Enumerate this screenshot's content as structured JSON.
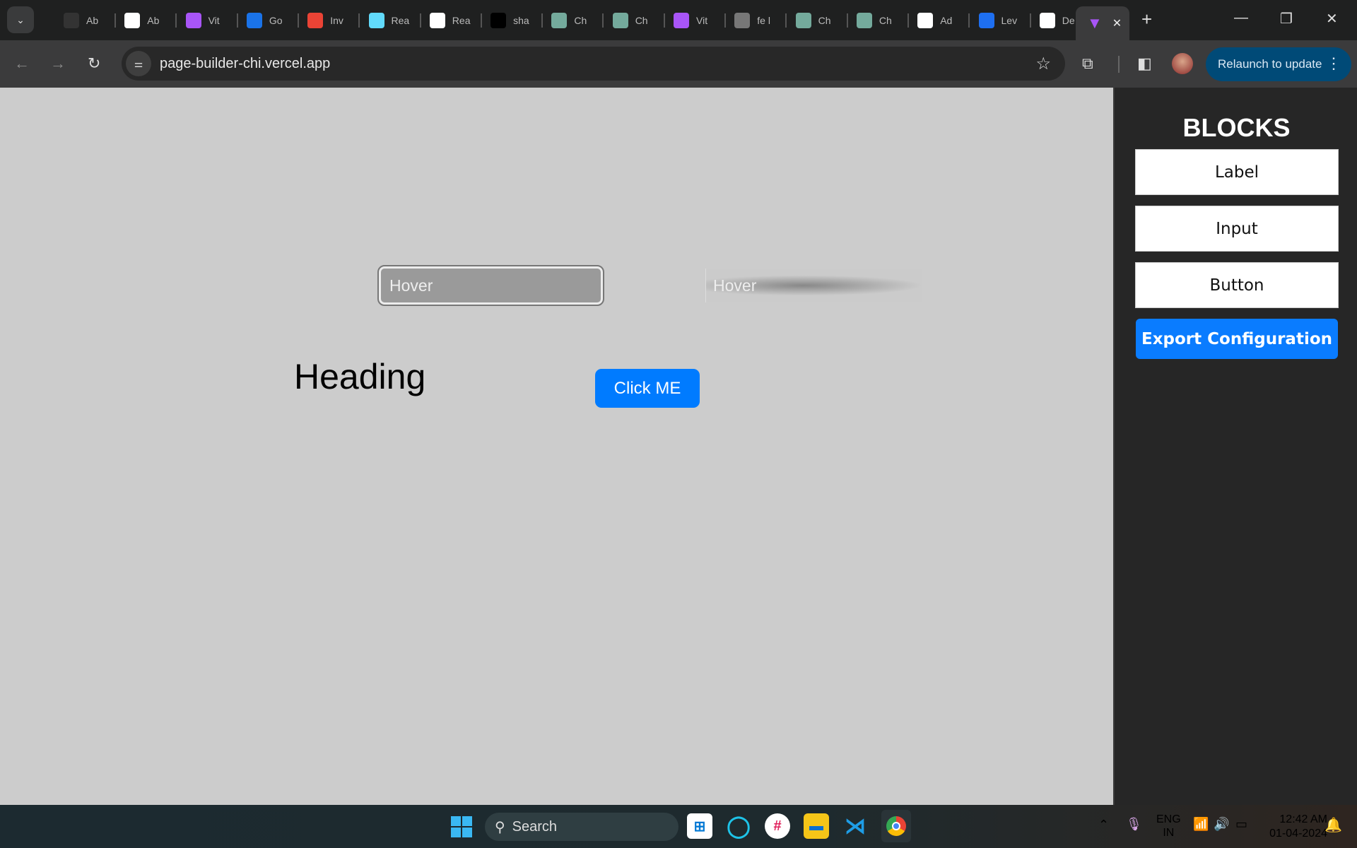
{
  "browser": {
    "tabs": [
      {
        "label": "Ab",
        "icon": "github-icon",
        "color": "#333"
      },
      {
        "label": "Ab",
        "icon": "github-icon",
        "color": "#fff"
      },
      {
        "label": "Vit",
        "icon": "vite-icon",
        "color": "#a855f7"
      },
      {
        "label": "Go",
        "icon": "google-calendar-icon",
        "color": "#1a73e8"
      },
      {
        "label": "Inv",
        "icon": "gmail-icon",
        "color": "#ea4335"
      },
      {
        "label": "Rea",
        "icon": "react-icon",
        "color": "#61dafb"
      },
      {
        "label": "Rea",
        "icon": "dnd-icon",
        "color": "#ffffff"
      },
      {
        "label": "sha",
        "icon": "shadcn-icon",
        "color": "#000000"
      },
      {
        "label": "Ch",
        "icon": "chatgpt-icon",
        "color": "#74aa9c"
      },
      {
        "label": "Ch",
        "icon": "chatgpt-icon",
        "color": "#74aa9c"
      },
      {
        "label": "Vit",
        "icon": "vite-icon",
        "color": "#a855f7"
      },
      {
        "label": "fe l",
        "icon": "globe-icon",
        "color": "#777"
      },
      {
        "label": "Ch",
        "icon": "chatgpt-icon",
        "color": "#74aa9c"
      },
      {
        "label": "Ch",
        "icon": "chatgpt-icon",
        "color": "#74aa9c"
      },
      {
        "label": "Ad",
        "icon": "notion-icon",
        "color": "#ffffff"
      },
      {
        "label": "Lev",
        "icon": "lu-icon",
        "color": "#1e6ff0"
      },
      {
        "label": "De",
        "icon": "github-icon",
        "color": "#fff"
      }
    ],
    "active_tab": {
      "icon": "vite-icon",
      "close": "✕"
    },
    "url": "page-builder-chi.vercel.app",
    "relaunch_label": "Relaunch to update"
  },
  "canvas": {
    "input1_value": "Hover",
    "input2_value": "Hover",
    "heading": "Heading",
    "button_label": "Click ME"
  },
  "sidebar": {
    "title": "BLOCKS",
    "blocks": [
      "Label",
      "Input",
      "Button"
    ],
    "export_label": "Export Configuration",
    "accent": "#0a7cff"
  },
  "taskbar": {
    "search_label": "Search",
    "lang": "ENG",
    "region": "IN",
    "time": "12:42 AM",
    "date": "01-04-2024"
  }
}
